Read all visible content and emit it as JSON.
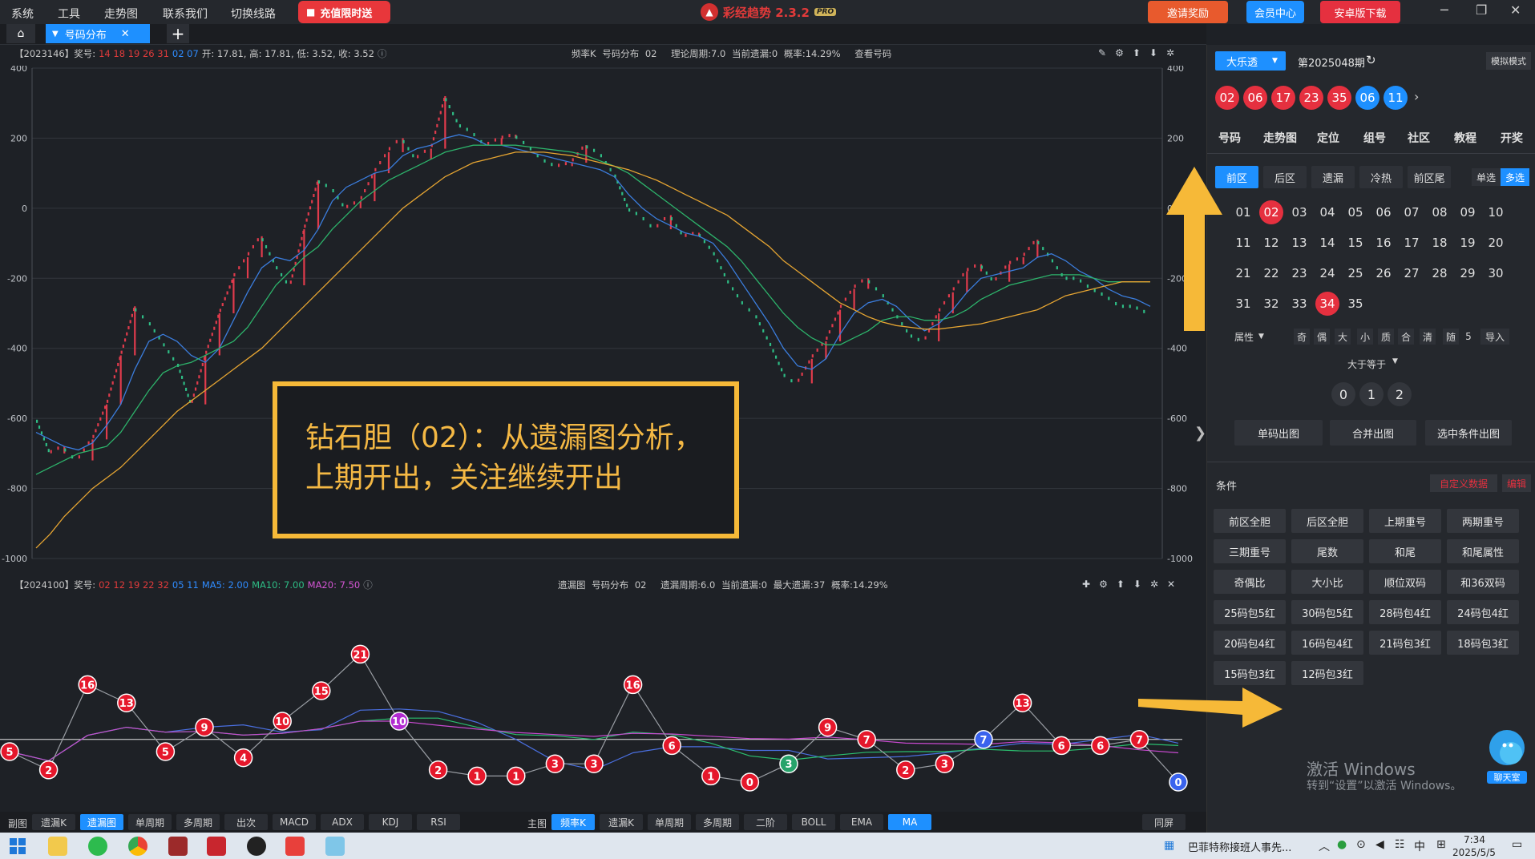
{
  "menu": [
    "系统",
    "工具",
    "走势图",
    "联系我们",
    "切换线路"
  ],
  "promo_button": "充值限时送",
  "app_title": "彩经趋势 2.3.2",
  "app_badge": "PRO",
  "top_buttons": {
    "invite": "邀请奖励",
    "member": "会员中心",
    "android": "安卓版下载"
  },
  "tabs": {
    "doc_tab": "号码分布",
    "add": "+"
  },
  "top_panel": {
    "issue": "【2023146】奖号:",
    "red_numbers": "14 18 19 26 31",
    "blue_numbers": "02 07",
    "ohlc": "开: 17.81, 高: 17.81, 低: 3.52, 收: 3.52",
    "mode": "频率K",
    "dist": "号码分布",
    "code": "02",
    "period": "理论周期:7.0",
    "miss": "当前遗漏:0",
    "prob": "概率:14.29%",
    "view": "查看号码"
  },
  "bottom_panel": {
    "issue": "【2024100】奖号:",
    "red_numbers": "02 12 19 22 32",
    "blue_numbers": "05 11",
    "ma5": "MA5: 2.00",
    "ma10": "MA10: 7.00",
    "ma20": "MA20: 7.50",
    "mode": "遗漏图",
    "dist": "号码分布",
    "code": "02",
    "period": "遗漏周期:6.0",
    "miss": "当前遗漏:0",
    "maxmiss": "最大遗漏:37",
    "prob": "概率:14.29%"
  },
  "annotation": {
    "line1": "钻石胆（02）：从遗漏图分析，",
    "line2": "上期开出，关注继续开出"
  },
  "y_axis_labels": [
    "400",
    "200",
    "0",
    "-200",
    "-400",
    "-600",
    "-800",
    "-1000"
  ],
  "chart_data": [
    {
      "type": "line",
      "title": "频率K",
      "ylim": [
        -1000,
        400
      ],
      "series": [
        {
          "name": "K",
          "color": "#2ebd85",
          "values": [
            -600,
            -700,
            -680,
            -720,
            -660,
            -560,
            -420,
            -280,
            -320,
            -380,
            -440,
            -560,
            -420,
            -300,
            -200,
            -140,
            -80,
            -160,
            -220,
            -60,
            80,
            60,
            0,
            20,
            100,
            160,
            200,
            140,
            170,
            320,
            240,
            220,
            180,
            200,
            210,
            180,
            140,
            120,
            130,
            180,
            160,
            100,
            0,
            -20,
            -60,
            -20,
            -80,
            -70,
            -120,
            -200,
            -260,
            -300,
            -380,
            -470,
            -500,
            -430,
            -380,
            -290,
            -230,
            -200,
            -240,
            -300,
            -360,
            -380,
            -300,
            -240,
            -180,
            -160,
            -210,
            -160,
            -140,
            -90,
            -140,
            -200,
            -200,
            -230,
            -250,
            -280,
            -280,
            -300
          ]
        },
        {
          "name": "MA5",
          "color": "#3b7ddd",
          "values": [
            -640,
            -660,
            -680,
            -690,
            -670,
            -620,
            -560,
            -460,
            -380,
            -360,
            -380,
            -420,
            -440,
            -400,
            -320,
            -240,
            -170,
            -140,
            -150,
            -120,
            -60,
            20,
            60,
            80,
            100,
            110,
            150,
            170,
            180,
            200,
            210,
            200,
            180,
            180,
            170,
            160,
            150,
            140,
            130,
            120,
            110,
            90,
            40,
            0,
            -30,
            -50,
            -70,
            -80,
            -100,
            -150,
            -210,
            -270,
            -330,
            -400,
            -450,
            -460,
            -430,
            -360,
            -300,
            -270,
            -260,
            -280,
            -320,
            -350,
            -330,
            -290,
            -240,
            -200,
            -190,
            -180,
            -170,
            -140,
            -130,
            -150,
            -180,
            -200,
            -230,
            -250,
            -260,
            -280
          ]
        },
        {
          "name": "MA10",
          "color": "#2db36b",
          "values": [
            -760,
            -740,
            -720,
            -700,
            -690,
            -680,
            -640,
            -580,
            -520,
            -470,
            -450,
            -440,
            -420,
            -400,
            -380,
            -340,
            -280,
            -220,
            -180,
            -140,
            -110,
            -60,
            -20,
            20,
            50,
            80,
            100,
            120,
            140,
            160,
            170,
            180,
            180,
            180,
            180,
            175,
            170,
            165,
            160,
            150,
            135,
            120,
            100,
            70,
            40,
            10,
            -20,
            -50,
            -80,
            -110,
            -150,
            -200,
            -250,
            -300,
            -340,
            -370,
            -390,
            -390,
            -370,
            -350,
            -320,
            -310,
            -310,
            -320,
            -320,
            -310,
            -290,
            -260,
            -240,
            -220,
            -210,
            -200,
            -190,
            -190,
            -190,
            -200,
            -210,
            -210,
            -210,
            -210
          ]
        },
        {
          "name": "MA20",
          "color": "#e6a532",
          "values": [
            -970,
            -930,
            -880,
            -840,
            -800,
            -770,
            -740,
            -700,
            -660,
            -620,
            -580,
            -550,
            -520,
            -490,
            -460,
            -430,
            -400,
            -360,
            -320,
            -280,
            -240,
            -200,
            -160,
            -120,
            -80,
            -40,
            0,
            30,
            60,
            90,
            110,
            130,
            140,
            150,
            160,
            160,
            160,
            155,
            150,
            140,
            130,
            120,
            110,
            95,
            80,
            60,
            40,
            20,
            0,
            -20,
            -50,
            -80,
            -110,
            -150,
            -180,
            -210,
            -240,
            -270,
            -290,
            -310,
            -325,
            -335,
            -340,
            -345,
            -345,
            -340,
            -335,
            -330,
            -320,
            -310,
            -300,
            -290,
            -270,
            -250,
            -240,
            -230,
            -220,
            -210,
            -210,
            -210
          ]
        }
      ]
    },
    {
      "type": "line",
      "title": "遗漏图",
      "points": [
        {
          "v": 5,
          "c": "red"
        },
        {
          "v": 2,
          "c": "red"
        },
        {
          "v": 16,
          "c": "red"
        },
        {
          "v": 13,
          "c": "red"
        },
        {
          "v": 5,
          "c": "red"
        },
        {
          "v": 9,
          "c": "red"
        },
        {
          "v": 4,
          "c": "red"
        },
        {
          "v": 10,
          "c": "red"
        },
        {
          "v": 15,
          "c": "red"
        },
        {
          "v": 21,
          "c": "red"
        },
        {
          "v": 10,
          "c": "purple"
        },
        {
          "v": 2,
          "c": "red"
        },
        {
          "v": 1,
          "c": "red"
        },
        {
          "v": 1,
          "c": "red"
        },
        {
          "v": 3,
          "c": "red"
        },
        {
          "v": 3,
          "c": "red"
        },
        {
          "v": 16,
          "c": "red"
        },
        {
          "v": 6,
          "c": "red"
        },
        {
          "v": 1,
          "c": "red"
        },
        {
          "v": 0,
          "c": "red"
        },
        {
          "v": 3,
          "c": "green"
        },
        {
          "v": 9,
          "c": "red"
        },
        {
          "v": 7,
          "c": "red"
        },
        {
          "v": 2,
          "c": "red"
        },
        {
          "v": 3,
          "c": "red"
        },
        {
          "v": 7,
          "c": "blue"
        },
        {
          "v": 13,
          "c": "red"
        },
        {
          "v": 6,
          "c": "red"
        },
        {
          "v": 6,
          "c": "red"
        },
        {
          "v": 7,
          "c": "red"
        },
        {
          "v": 0,
          "c": "blue"
        }
      ]
    }
  ],
  "bottom_tabs_left": {
    "label": "副图",
    "tabs": [
      "遗漏K",
      "遗漏图",
      "单周期",
      "多周期",
      "出次",
      "MACD",
      "ADX",
      "KDJ",
      "RSI"
    ],
    "active": "遗漏图"
  },
  "bottom_tabs_right": {
    "label": "主图",
    "tabs": [
      "频率K",
      "遗漏K",
      "单周期",
      "多周期",
      "二阶",
      "BOLL",
      "EMA",
      "MA"
    ],
    "active": [
      "频率K",
      "MA"
    ]
  },
  "sync_button": "同屏",
  "sidebar": {
    "lottery": "大乐透",
    "issue": "第2025048期",
    "sim_mode": "模拟模式",
    "draw_red": [
      "02",
      "06",
      "17",
      "23",
      "35"
    ],
    "draw_blue": [
      "06",
      "11"
    ],
    "nav": [
      "号码",
      "走势图",
      "定位",
      "组号",
      "社区",
      "教程",
      "开奖"
    ],
    "seg": [
      "前区",
      "后区",
      "遗漏",
      "冷热",
      "前区尾"
    ],
    "single": "单选",
    "multi": "多选",
    "numbers": [
      "01",
      "02",
      "03",
      "04",
      "05",
      "06",
      "07",
      "08",
      "09",
      "10",
      "11",
      "12",
      "13",
      "14",
      "15",
      "16",
      "17",
      "18",
      "19",
      "20",
      "21",
      "22",
      "23",
      "24",
      "25",
      "26",
      "27",
      "28",
      "29",
      "30",
      "31",
      "32",
      "33",
      "34",
      "35"
    ],
    "selected": [
      "02",
      "34"
    ],
    "attr_label": "属性",
    "attrs": [
      "奇",
      "偶",
      "大",
      "小",
      "质",
      "合",
      "清",
      "随",
      "5",
      "导入"
    ],
    "gte": "大于等于",
    "gte_options": [
      "0",
      "1",
      "2"
    ],
    "actions": [
      "单码出图",
      "合并出图",
      "选中条件出图"
    ],
    "cond_label": "条件",
    "custom_data": "自定义数据",
    "edit": "编辑",
    "conditions": [
      "前区全胆",
      "后区全胆",
      "上期重号",
      "两期重号",
      "三期重号",
      "尾数",
      "和尾",
      "和尾属性",
      "奇偶比",
      "大小比",
      "顺位双码",
      "和36双码",
      "25码包5红",
      "30码包5红",
      "28码包4红",
      "24码包4红",
      "20码包4红",
      "16码包4红",
      "21码包3红",
      "18码包3红",
      "15码包3红",
      "12码包3红"
    ],
    "chat": "聊天室",
    "activate1": "激活 Windows",
    "activate2": "转到“设置”以激活 Windows。"
  },
  "taskbar": {
    "news": "巴菲特称接班人事先...",
    "ime": "中",
    "time": "7:34",
    "date": "2025/5/5"
  }
}
